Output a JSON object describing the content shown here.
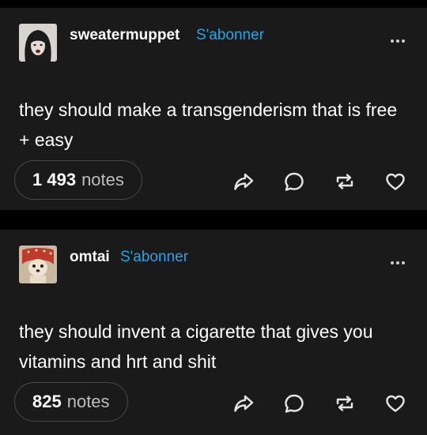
{
  "posts": [
    {
      "username": "sweatermuppet",
      "follow_label": "S'abonner",
      "body": "they should make a transgenderism that is free + easy",
      "notes_count": "1 493",
      "notes_word": "notes",
      "avatar": "dark-haired-person-avatar"
    },
    {
      "username": "omtai",
      "follow_label": "S'abonner",
      "body": "they should invent a cigarette that gives you vitamins and hrt and shit",
      "notes_count": "825",
      "notes_word": "notes",
      "avatar": "small-dog-in-red-hood-avatar"
    }
  ],
  "icons": [
    "more-icon",
    "share-icon",
    "reply-icon",
    "reblog-icon",
    "like-icon"
  ],
  "colors": {
    "background": "#000000",
    "card": "#1a1a1a",
    "follow_accent": "#29a3e6",
    "text": "#ffffff",
    "muted": "#bdbdbd"
  }
}
